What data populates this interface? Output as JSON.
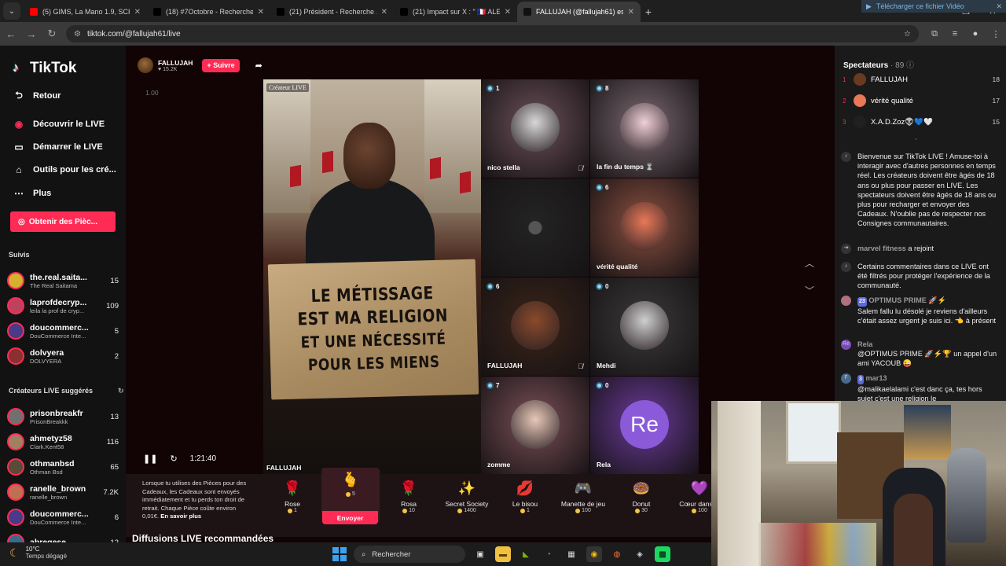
{
  "browser": {
    "tabs": [
      {
        "title": "(5) GIMS, La Mano 1.9, SCH - U",
        "fav_color": "#ff0000"
      },
      {
        "title": "(18) #7Octobre - Recherche / X",
        "fav_color": "#000000"
      },
      {
        "title": "(21) Président - Recherche / X",
        "fav_color": "#000000"
      },
      {
        "title": "(21) Impact sur X : \" 🇫🇷 ALERT",
        "fav_color": "#000000"
      },
      {
        "title": "FALLUJAH (@fallujah61) est",
        "fav_color": "#111111",
        "active": true
      }
    ],
    "url": "tiktok.com/@fallujah61/live"
  },
  "sidebar": {
    "brand": "TikTok",
    "back": "Retour",
    "items": [
      {
        "label": "Découvrir le LIVE",
        "icon": "discover-live-icon"
      },
      {
        "label": "Démarrer le LIVE",
        "icon": "camera-icon"
      },
      {
        "label": "Outils pour les cré...",
        "icon": "home-tools-icon"
      },
      {
        "label": "Plus",
        "icon": "more-icon"
      }
    ],
    "coins_button": "Obtenir des Pièc...",
    "followed_title": "Suivis",
    "followed": [
      {
        "name": "the.real.saita...",
        "sub": "The Real Saitama",
        "count": "15",
        "color": "#d8b030"
      },
      {
        "name": "laprofdecryp...",
        "sub": "leila la prof de cryp...",
        "count": "109",
        "color": "#c04060"
      },
      {
        "name": "doucommerc...",
        "sub": "DouCommerce Inte...",
        "count": "5",
        "color": "#4a3a8a"
      },
      {
        "name": "dolvyera",
        "sub": "DOLVYERA",
        "count": "2",
        "color": "#8a3030"
      }
    ],
    "suggested_title": "Créateurs LIVE suggérés",
    "suggested": [
      {
        "name": "prisonbreakfr",
        "sub": "PrisonBreakkk",
        "count": "13",
        "color": "#707070"
      },
      {
        "name": "ahmetyz58",
        "sub": "Clark.Kent58",
        "count": "116",
        "color": "#a08060"
      },
      {
        "name": "othmanbsd",
        "sub": "Othman Bsd",
        "count": "65",
        "color": "#5a4a3a"
      },
      {
        "name": "ranelle_brown",
        "sub": "ranelle_brown",
        "count": "7.2K",
        "color": "#c07050"
      },
      {
        "name": "doucommerc...",
        "sub": "DouCommerce Inte...",
        "count": "6",
        "color": "#4a3a8a"
      },
      {
        "name": "abregese...",
        "sub": "",
        "count": "12",
        "color": "#3a6a8a"
      }
    ]
  },
  "host": {
    "name": "FALLUJAH",
    "likes": "15.2K",
    "follow": "+ Suivre"
  },
  "stream": {
    "ratio_label": "1.00",
    "creator_tag": "Créateur LIVE",
    "host_label": "FALLUJAH",
    "sign_lines": [
      "LE MÉTISSAGE",
      "EST MA RELIGION",
      "ET UNE NÉCESSITÉ",
      "POUR LES MIENS"
    ],
    "guests": [
      {
        "name": "nico stella",
        "viewers": "1",
        "muted": true,
        "avatar_color": "#d8d8d8",
        "bg": "#6a5058"
      },
      {
        "name": "la fin du temps ⏳",
        "viewers": "8",
        "muted": false,
        "avatar_color": "#f0d0d8",
        "bg": "#7a6870"
      },
      {
        "name": "",
        "viewers": "",
        "muted": false,
        "avatar_color": "#3a3a3a",
        "bg": "#242424"
      },
      {
        "name": "vérité qualité",
        "viewers": "6",
        "muted": false,
        "avatar_color": "#e87858",
        "bg": "#8a5040"
      },
      {
        "name": "FALLUJAH",
        "viewers": "6",
        "muted": true,
        "avatar_color": "#8a4a2a",
        "bg": "#3a2418"
      },
      {
        "name": "Mehdi",
        "viewers": "0",
        "muted": false,
        "avatar_color": "#cfcfcf",
        "bg": "#3a3a3a"
      },
      {
        "name": "zomme",
        "viewers": "7",
        "muted": false,
        "avatar_color": "#e8c8b8",
        "bg": "#7a5058"
      },
      {
        "name": "Rela",
        "viewers": "0",
        "muted": false,
        "avatar_color": "#8a5ad8",
        "bg": "#6a3a9a",
        "initials": "Re"
      }
    ],
    "time": "1:21:40"
  },
  "gifts": {
    "info_text": "Lorsque tu utilises des Pièces pour des Cadeaux, les Cadeaux sont envoyés immédiatement et tu perds ton droit de retrait. Chaque Pièce coûte environ 0,01€.",
    "info_link": "En savoir plus",
    "send": "Envoyer",
    "items": [
      {
        "name": "Rose",
        "price": "1",
        "icon": "🌹"
      },
      {
        "name": "",
        "price": "5",
        "icon": "🫰",
        "selected": true
      },
      {
        "name": "Rosa",
        "price": "10",
        "icon": "🌹"
      },
      {
        "name": "Secret Society",
        "price": "1400",
        "icon": "✨"
      },
      {
        "name": "Le bisou",
        "price": "1",
        "icon": "💋"
      },
      {
        "name": "Manette de jeu",
        "price": "100",
        "icon": "🎮"
      },
      {
        "name": "Donut",
        "price": "30",
        "icon": "🍩"
      },
      {
        "name": "Cœur dans le",
        "price": "100",
        "icon": "💜"
      }
    ]
  },
  "recommended": "Diffusions LIVE recommandées",
  "right_panel": {
    "download_bar": "Télécharger ce fichier Vidéo",
    "spectators_title": "Spectateurs",
    "spectators_count": "· 89",
    "ranking": [
      {
        "rank": "1",
        "name": "FALLUJAH",
        "count": "18",
        "color": "#6a3a20"
      },
      {
        "rank": "2",
        "name": "vérité qualité",
        "count": "17",
        "color": "#e87858"
      },
      {
        "rank": "3",
        "name": "X.A.D.Zoz👽💙🤍",
        "count": "15",
        "color": "#202020"
      }
    ],
    "messages": [
      {
        "user": "",
        "text": "Bienvenue sur TikTok LIVE ! Amuse-toi à interagir avec d'autres personnes en temps réel. Les créateurs doivent être âgés de 18 ans ou plus pour passer en LIVE. Les spectateurs doivent être âgés de 18 ans ou plus pour recharger et envoyer des Cadeaux. N'oublie pas de respecter nos Consignes communautaires.",
        "icon": "tiktok-icon"
      },
      {
        "user": "marvel fitness",
        "text": "a rejoint",
        "icon": "join-icon"
      },
      {
        "user": "",
        "text": "Certains commentaires dans ce LIVE ont été filtrés pour protéger l'expérience de la communauté.",
        "icon": "tiktok-icon"
      },
      {
        "user": "OPTIMUS PRIME 🚀⚡",
        "badge": "23",
        "text": "Salem fallu lu désolé je reviens d'ailleurs c'était assez urgent je suis ici. 👈 à présent",
        "icon": "avatar"
      },
      {
        "user": "Rela",
        "text": "@OPTIMUS PRIME 🚀⚡🏆 un appel d'un ami YACOUB 😜",
        "icon": "avatar-re"
      },
      {
        "user": "mar13",
        "badge": "3",
        "text": "@malikaelalami c'est danc ça, tes hors sujet  c'est une religion le",
        "icon": "avatar-f"
      }
    ]
  },
  "taskbar": {
    "temperature": "10°C",
    "weather": "Temps dégagé",
    "search_placeholder": "Rechercher"
  }
}
